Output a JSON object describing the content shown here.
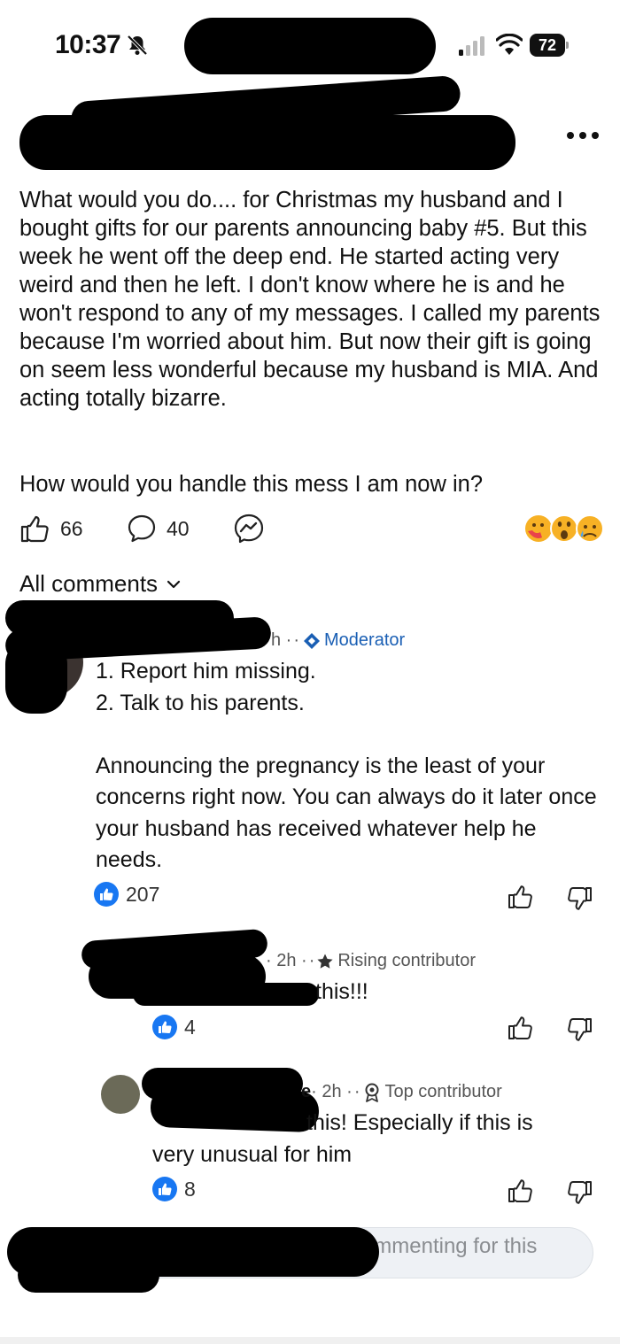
{
  "status_bar": {
    "time": "10:37",
    "battery": "72"
  },
  "post": {
    "body": "What would you do.... for Christmas my husband and I bought gifts for our parents announcing baby #5. But this week he went off the deep end. He started acting very weird and then he left. I don't know where he is and he won't respond to any of my messages. I called my parents because I'm worried about him. But now their gift is going on seem less wonderful because my husband is MIA. And acting totally bizarre.",
    "question": "How would you handle this mess I am now in?",
    "likes": "66",
    "comments": "40"
  },
  "comments_header": {
    "label": "All comments"
  },
  "comments": [
    {
      "time_fragment": "h · ",
      "badge": "Moderator",
      "text": "1. Report him missing.\n2. Talk to his parents.\n\nAnnouncing the pregnancy is the least of your concerns right now. You can always do it later once your husband has received whatever help he needs.",
      "likes": "207"
    },
    {
      "time": "· 2h · ",
      "badge": "Rising contributor",
      "text": "this!!!",
      "likes": "4"
    },
    {
      "name_fragment": "e",
      "time": " · 2h · ",
      "badge": "Top contributor",
      "text_line1": "this! Especially if this is",
      "text_line2": "very unusual for him",
      "likes": "8"
    }
  ],
  "comment_bar": {
    "placeholder_fragment": "off commenting for this"
  },
  "icons": {
    "bell": "bell-slash-icon",
    "like": "thumbs-up-icon",
    "comment": "comment-bubble-icon",
    "messenger": "messenger-icon",
    "dislike": "thumbs-down-icon"
  },
  "colors": {
    "accent": "#1877f2",
    "moderator": "#1a5fb4",
    "meta": "#555555"
  }
}
